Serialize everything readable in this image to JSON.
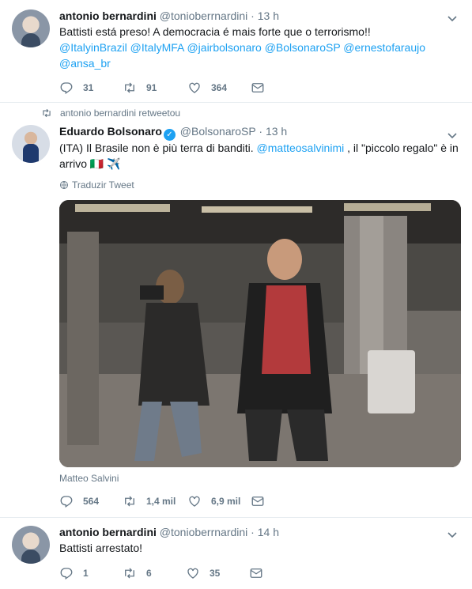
{
  "tweet1": {
    "name": "antonio bernardini",
    "handle": "@tonioberrnardini",
    "sep": "·",
    "time": "13 h",
    "text": "Battisti está preso! A democracia é mais forte que o terrorismo!!",
    "mentions": "@ItalyinBrazil @ItalyMFA @jairbolsonaro @BolsonaroSP @ernestofaraujo @ansa_br",
    "replies": "31",
    "retweets": "91",
    "likes": "364"
  },
  "retweet_label": "antonio bernardini retweetou",
  "tweet2": {
    "name": "Eduardo Bolsonaro",
    "verified_icon": "✓",
    "handle": "@BolsonaroSP",
    "sep": "·",
    "time": "13 h",
    "text_line1_a": "(ITA) Il Brasile non è più terra di banditi. ",
    "text_mention": "@matteosalvinimi",
    "text_line1_b": " , il \"piccolo regalo\" è in",
    "text_line2": "arrivo 🇮🇹 ✈️",
    "translate": "Traduzir Tweet",
    "media_credit": "Matteo Salvini",
    "replies": "564",
    "retweets": "1,4 mil",
    "likes": "6,9 mil"
  },
  "tweet3": {
    "name": "antonio bernardini",
    "handle": "@tonioberrnardini",
    "sep": "·",
    "time": "14 h",
    "text": "Battisti arrestato!",
    "replies": "1",
    "retweets": "6",
    "likes": "35"
  },
  "icons": [
    "reply-icon",
    "retweet-icon",
    "like-icon",
    "dm-icon",
    "chevron-down-icon",
    "globe-icon",
    "verified-icon"
  ]
}
